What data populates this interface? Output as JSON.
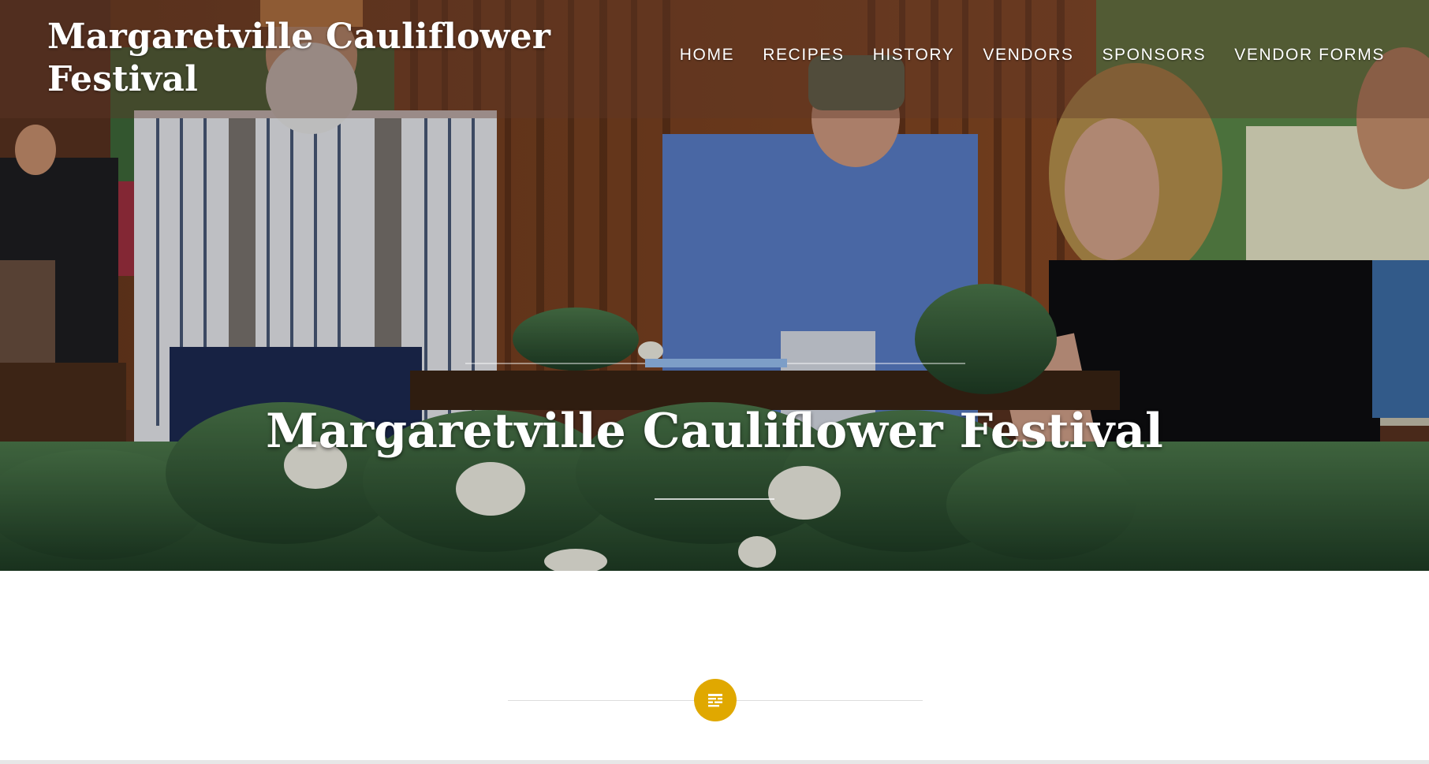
{
  "site": {
    "title": "Margaretville Cauliflower Festival"
  },
  "nav": {
    "items": [
      {
        "label": "HOME"
      },
      {
        "label": "RECIPES"
      },
      {
        "label": "HISTORY"
      },
      {
        "label": "VENDORS"
      },
      {
        "label": "SPONSORS"
      },
      {
        "label": "VENDOR FORMS"
      }
    ]
  },
  "hero": {
    "title": "Margaretville Cauliflower Festival"
  },
  "colors": {
    "accent_bar": "#7d9ec7",
    "icon_badge": "#e0a800"
  },
  "icons": {
    "content_icon": "post-format-standard-icon"
  }
}
